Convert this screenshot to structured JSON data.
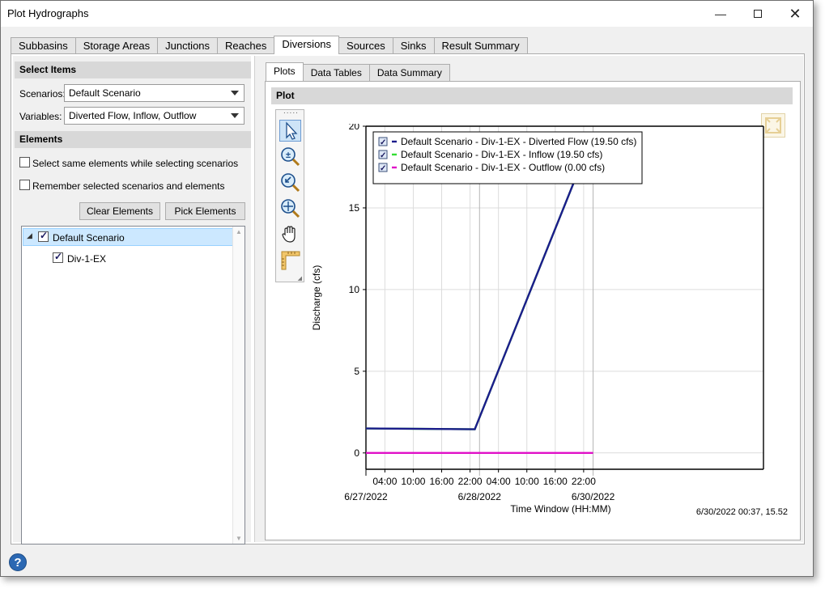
{
  "window": {
    "title": "Plot Hydrographs"
  },
  "main_tabs": [
    {
      "label": "Subbasins",
      "active": false
    },
    {
      "label": "Storage Areas",
      "active": false
    },
    {
      "label": "Junctions",
      "active": false
    },
    {
      "label": "Reaches",
      "active": false
    },
    {
      "label": "Diversions",
      "active": true
    },
    {
      "label": "Sources",
      "active": false
    },
    {
      "label": "Sinks",
      "active": false
    },
    {
      "label": "Result Summary",
      "active": false
    }
  ],
  "left": {
    "select_items_header": "Select Items",
    "scenarios_label": "Scenarios:",
    "scenarios_value": "Default Scenario",
    "variables_label": "Variables:",
    "variables_value": "Diverted Flow, Inflow, Outflow",
    "elements_header": "Elements",
    "option_same_elements": "Select same elements while selecting scenarios",
    "option_same_elements_checked": false,
    "option_remember": "Remember selected scenarios and elements",
    "option_remember_checked": false,
    "clear_button": "Clear Elements",
    "pick_button": "Pick Elements",
    "tree": {
      "root_label": "Default Scenario",
      "root_checked": true,
      "child_label": "Div-1-EX",
      "child_checked": true
    }
  },
  "inner_tabs": [
    {
      "label": "Plots",
      "active": true
    },
    {
      "label": "Data Tables",
      "active": false
    },
    {
      "label": "Data Summary",
      "active": false
    }
  ],
  "plot_header": "Plot",
  "toolbar_icons": [
    "pointer-icon",
    "zoom-icon",
    "zoom-previous-icon",
    "zoom-extents-icon",
    "pan-hand-icon",
    "ruler-icon"
  ],
  "status_readout": "6/30/2022 00:37, 15.52",
  "colors": {
    "diverted": "#1c1c8c",
    "inflow": "#33dd33",
    "outflow": "#e010c8"
  },
  "chart_data": {
    "type": "line",
    "ylabel": "Discharge (cfs)",
    "xlabel": "Time Window (HH:MM)",
    "ylim": [
      -1,
      20
    ],
    "yticks": [
      0,
      5,
      10,
      15,
      20
    ],
    "x_unit": "hours from 6/27/2022 00:00",
    "xlim": [
      0,
      84
    ],
    "xticks": [
      {
        "x": 4,
        "label": "04:00"
      },
      {
        "x": 10,
        "label": "10:00"
      },
      {
        "x": 16,
        "label": "16:00"
      },
      {
        "x": 22,
        "label": "22:00"
      },
      {
        "x": 28,
        "label": "04:00"
      },
      {
        "x": 34,
        "label": "10:00"
      },
      {
        "x": 40,
        "label": "16:00"
      },
      {
        "x": 46,
        "label": "22:00"
      }
    ],
    "date_labels": [
      {
        "x": 0,
        "label": "6/27/2022"
      },
      {
        "x": 24,
        "label": "6/28/2022"
      },
      {
        "x": 48,
        "label": "6/30/2022"
      }
    ],
    "legend_position": "top-left",
    "series": [
      {
        "name": "Default Scenario - Div-1-EX - Diverted Flow (19.50 cfs)",
        "color_key": "diverted",
        "checked": true,
        "x": [
          0,
          23,
          48
        ],
        "y": [
          1.5,
          1.45,
          19.5
        ]
      },
      {
        "name": "Default Scenario - Div-1-EX - Inflow (19.50 cfs)",
        "color_key": "inflow",
        "checked": true,
        "x": [
          0,
          23,
          48
        ],
        "y": [
          1.5,
          1.45,
          19.5
        ]
      },
      {
        "name": "Default Scenario - Div-1-EX - Outflow (0.00 cfs)",
        "color_key": "outflow",
        "checked": true,
        "x": [
          0,
          48
        ],
        "y": [
          0,
          0
        ]
      }
    ]
  }
}
